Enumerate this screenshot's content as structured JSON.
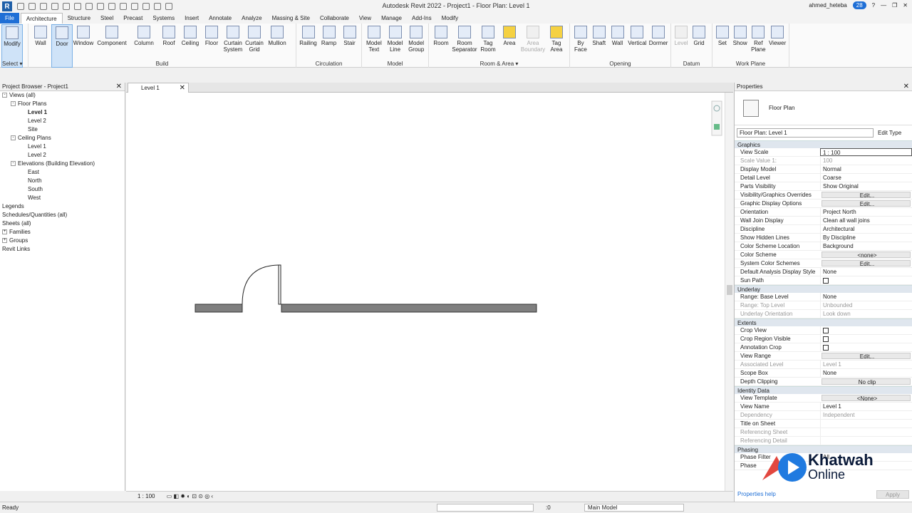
{
  "window": {
    "title": "Autodesk Revit 2022 - Project1 - Floor Plan: Level 1"
  },
  "user": {
    "name": "ahmed_heteba",
    "badge": "28"
  },
  "tabs": [
    "File",
    "Architecture",
    "Structure",
    "Steel",
    "Precast",
    "Systems",
    "Insert",
    "Annotate",
    "Analyze",
    "Massing & Site",
    "Collaborate",
    "View",
    "Manage",
    "Add-Ins",
    "Modify"
  ],
  "ribbon": {
    "select": {
      "tools": [
        "Modify"
      ],
      "title": "Select ▾"
    },
    "build": {
      "tools": [
        "Wall",
        "Door",
        "Window",
        "Component",
        "Column",
        "Roof",
        "Ceiling",
        "Floor",
        "Curtain System",
        "Curtain Grid",
        "Mullion"
      ],
      "title": "Build"
    },
    "circulation": {
      "tools": [
        "Railing",
        "Ramp",
        "Stair"
      ],
      "title": "Circulation"
    },
    "model": {
      "tools": [
        "Model Text",
        "Model Line",
        "Model Group"
      ],
      "title": "Model"
    },
    "roomarea": {
      "tools": [
        "Room",
        "Room Separator",
        "Tag Room",
        "Area",
        "Area Boundary",
        "Tag Area"
      ],
      "title": "Room & Area ▾"
    },
    "opening": {
      "tools": [
        "By Face",
        "Shaft",
        "Wall",
        "Vertical",
        "Dormer"
      ],
      "title": "Opening"
    },
    "datum": {
      "tools": [
        "Level",
        "Grid"
      ],
      "title": "Datum"
    },
    "workplane": {
      "tools": [
        "Set",
        "Show",
        "Ref Plane",
        "Viewer"
      ],
      "title": "Work Plane"
    }
  },
  "browser": {
    "title": "Project Browser - Project1",
    "items": [
      {
        "label": "Views (all)",
        "indent": 0,
        "toggle": "-"
      },
      {
        "label": "Floor Plans",
        "indent": 1,
        "toggle": "-"
      },
      {
        "label": "Level 1",
        "indent": 3,
        "toggle": "",
        "bold": true
      },
      {
        "label": "Level 2",
        "indent": 3,
        "toggle": ""
      },
      {
        "label": "Site",
        "indent": 3,
        "toggle": ""
      },
      {
        "label": "Ceiling Plans",
        "indent": 1,
        "toggle": "-"
      },
      {
        "label": "Level 1",
        "indent": 3,
        "toggle": ""
      },
      {
        "label": "Level 2",
        "indent": 3,
        "toggle": ""
      },
      {
        "label": "Elevations (Building Elevation)",
        "indent": 1,
        "toggle": "-"
      },
      {
        "label": "East",
        "indent": 3,
        "toggle": ""
      },
      {
        "label": "North",
        "indent": 3,
        "toggle": ""
      },
      {
        "label": "South",
        "indent": 3,
        "toggle": ""
      },
      {
        "label": "West",
        "indent": 3,
        "toggle": ""
      },
      {
        "label": "Legends",
        "indent": 0,
        "toggle": ""
      },
      {
        "label": "Schedules/Quantities (all)",
        "indent": 0,
        "toggle": ""
      },
      {
        "label": "Sheets (all)",
        "indent": 0,
        "toggle": ""
      },
      {
        "label": "Families",
        "indent": 0,
        "toggle": "+"
      },
      {
        "label": "Groups",
        "indent": 0,
        "toggle": "+"
      },
      {
        "label": "Revit Links",
        "indent": 0,
        "toggle": ""
      }
    ]
  },
  "view": {
    "tab": "Level 1",
    "scale": "1 : 100"
  },
  "properties": {
    "title": "Properties",
    "type": "Floor Plan",
    "instance": "Floor Plan: Level 1",
    "edit_type": "Edit Type",
    "groups": [
      {
        "name": "Graphics",
        "rows": [
          {
            "k": "View Scale",
            "v": "1 : 100",
            "style": "edit"
          },
          {
            "k": "Scale Value    1:",
            "v": "100",
            "style": "dis"
          },
          {
            "k": "Display Model",
            "v": "Normal"
          },
          {
            "k": "Detail Level",
            "v": "Coarse"
          },
          {
            "k": "Parts Visibility",
            "v": "Show Original"
          },
          {
            "k": "Visibility/Graphics Overrides",
            "v": "Edit...",
            "style": "btn"
          },
          {
            "k": "Graphic Display Options",
            "v": "Edit...",
            "style": "btn"
          },
          {
            "k": "Orientation",
            "v": "Project North"
          },
          {
            "k": "Wall Join Display",
            "v": "Clean all wall joins"
          },
          {
            "k": "Discipline",
            "v": "Architectural"
          },
          {
            "k": "Show Hidden Lines",
            "v": "By Discipline"
          },
          {
            "k": "Color Scheme Location",
            "v": "Background"
          },
          {
            "k": "Color Scheme",
            "v": "<none>",
            "style": "btn"
          },
          {
            "k": "System Color Schemes",
            "v": "Edit...",
            "style": "btn"
          },
          {
            "k": "Default Analysis Display Style",
            "v": "None"
          },
          {
            "k": "Sun Path",
            "v": "",
            "style": "cb"
          }
        ]
      },
      {
        "name": "Underlay",
        "rows": [
          {
            "k": "Range: Base Level",
            "v": "None"
          },
          {
            "k": "Range: Top Level",
            "v": "Unbounded",
            "style": "dis"
          },
          {
            "k": "Underlay Orientation",
            "v": "Look down",
            "style": "dis"
          }
        ]
      },
      {
        "name": "Extents",
        "rows": [
          {
            "k": "Crop View",
            "v": "",
            "style": "cb"
          },
          {
            "k": "Crop Region Visible",
            "v": "",
            "style": "cb"
          },
          {
            "k": "Annotation Crop",
            "v": "",
            "style": "cb"
          },
          {
            "k": "View Range",
            "v": "Edit...",
            "style": "btn"
          },
          {
            "k": "Associated Level",
            "v": "Level 1",
            "style": "dis"
          },
          {
            "k": "Scope Box",
            "v": "None"
          },
          {
            "k": "Depth Clipping",
            "v": "No clip",
            "style": "btn"
          }
        ]
      },
      {
        "name": "Identity Data",
        "rows": [
          {
            "k": "View Template",
            "v": "<None>",
            "style": "btn"
          },
          {
            "k": "View Name",
            "v": "Level 1"
          },
          {
            "k": "Dependency",
            "v": "Independent",
            "style": "dis"
          },
          {
            "k": "Title on Sheet",
            "v": ""
          },
          {
            "k": "Referencing Sheet",
            "v": "",
            "style": "dis"
          },
          {
            "k": "Referencing Detail",
            "v": "",
            "style": "dis"
          }
        ]
      },
      {
        "name": "Phasing",
        "rows": [
          {
            "k": "Phase Filter",
            "v": "All"
          },
          {
            "k": "Phase",
            "v": ""
          }
        ]
      }
    ],
    "help": "Properties help",
    "apply": "Apply"
  },
  "logo": {
    "line1": "Khatwah",
    "line2": "Online"
  },
  "status": {
    "text": "Ready",
    "zero": ":0",
    "model": "Main Model"
  }
}
